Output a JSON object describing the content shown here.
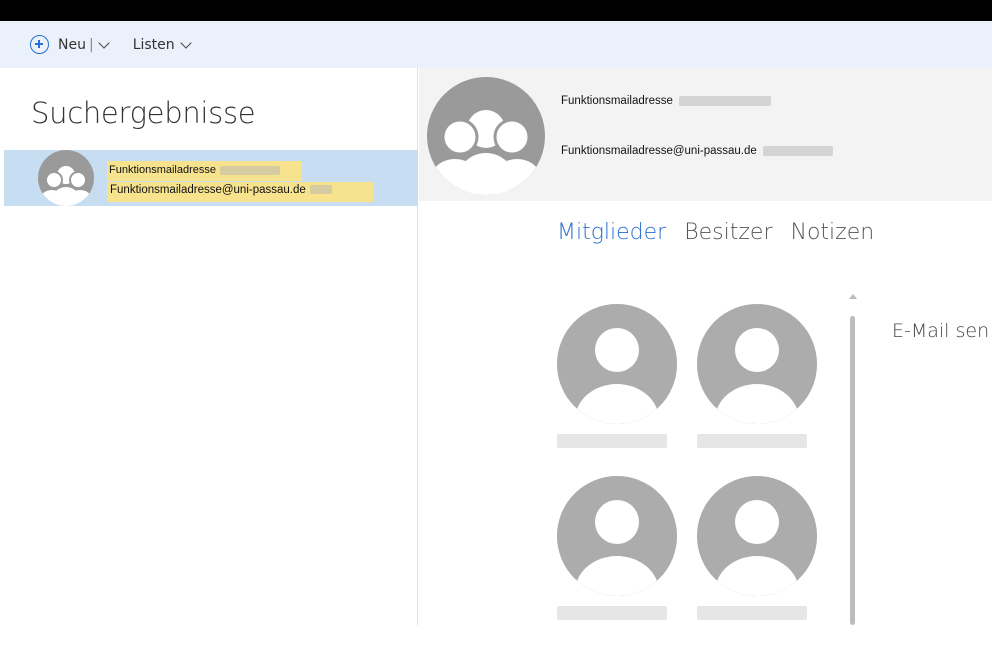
{
  "toolbar": {
    "new_label": "Neu",
    "separator": "|",
    "lists_label": "Listen",
    "new_icon": "plus-circle-icon"
  },
  "search": {
    "title": "Suchergebnisse",
    "results": [
      {
        "name": "Funktionsmailadresse",
        "email": "Funktionsmailadresse@uni-passau.de",
        "avatar_icon": "group-icon"
      }
    ]
  },
  "detail": {
    "name": "Funktionsmailadresse",
    "email": "Funktionsmailadresse@uni-passau.de",
    "avatar_icon": "group-icon",
    "tabs": [
      {
        "label": "Mitglieder",
        "active": true
      },
      {
        "label": "Besitzer",
        "active": false
      },
      {
        "label": "Notizen",
        "active": false
      }
    ],
    "action_label": "E-Mail sen"
  },
  "colors": {
    "accent": "#2a6fcf",
    "selection": "#c7ddf2",
    "highlight": "#f7e38e",
    "toolbar_bg": "#eaf1fa"
  }
}
